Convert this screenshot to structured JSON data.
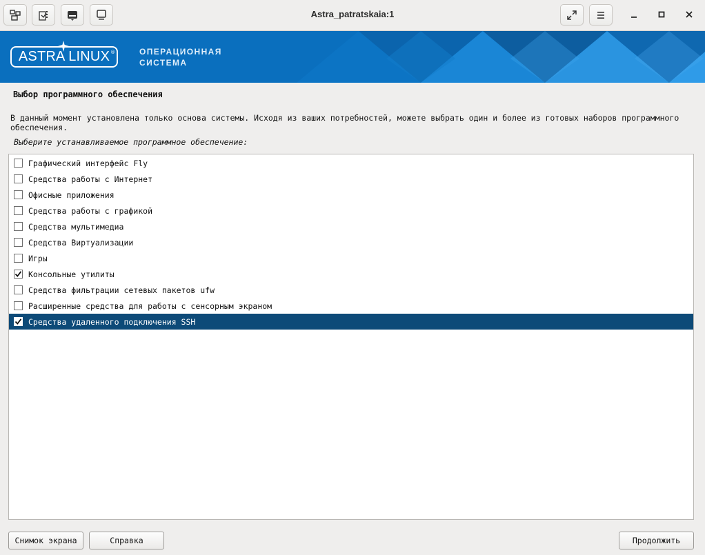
{
  "window": {
    "title": "Astra_patratskaia:1"
  },
  "toolbar": {
    "icons": [
      "windows-icon",
      "clipboard-icon",
      "keyboard-icon",
      "monitor-icon"
    ]
  },
  "window_controls": {
    "icons": [
      "fullscreen-icon",
      "menu-icon",
      "minimize-icon",
      "maximize-icon",
      "close-icon"
    ]
  },
  "banner": {
    "logo_text": "ASTRA LINUX",
    "logo_reg": "®",
    "os_line1": "ОПЕРАЦИОННАЯ",
    "os_line2": "СИСТЕМА",
    "colors": {
      "background": "#0a6fbe",
      "text": "#ffffff"
    }
  },
  "content": {
    "heading": "Выбор программного обеспечения",
    "description": "В данный момент установлена только основа системы. Исходя из ваших потребностей, можете выбрать один и более из готовых наборов программного обеспечения.",
    "prompt": "Выберите устанавливаемое программное обеспечение:"
  },
  "software_list": [
    {
      "label": "Графический интерфейс Fly",
      "checked": false,
      "selected": false
    },
    {
      "label": "Средства работы с Интернет",
      "checked": false,
      "selected": false
    },
    {
      "label": "Офисные приложения",
      "checked": false,
      "selected": false
    },
    {
      "label": "Средства работы с графикой",
      "checked": false,
      "selected": false
    },
    {
      "label": "Средства мультимедиа",
      "checked": false,
      "selected": false
    },
    {
      "label": "Средства Виртуализации",
      "checked": false,
      "selected": false
    },
    {
      "label": "Игры",
      "checked": false,
      "selected": false
    },
    {
      "label": "Консольные утилиты",
      "checked": true,
      "selected": false
    },
    {
      "label": "Средства фильтрации сетевых пакетов ufw",
      "checked": false,
      "selected": false
    },
    {
      "label": "Расширенные средства для работы с сенсорным экраном",
      "checked": false,
      "selected": false
    },
    {
      "label": "Средства удаленного подключения SSH",
      "checked": true,
      "selected": true
    }
  ],
  "colors": {
    "selection": "#0d4a78"
  },
  "buttons": {
    "screenshot": "Снимок экрана",
    "help": "Справка",
    "continue": "Продолжить"
  }
}
